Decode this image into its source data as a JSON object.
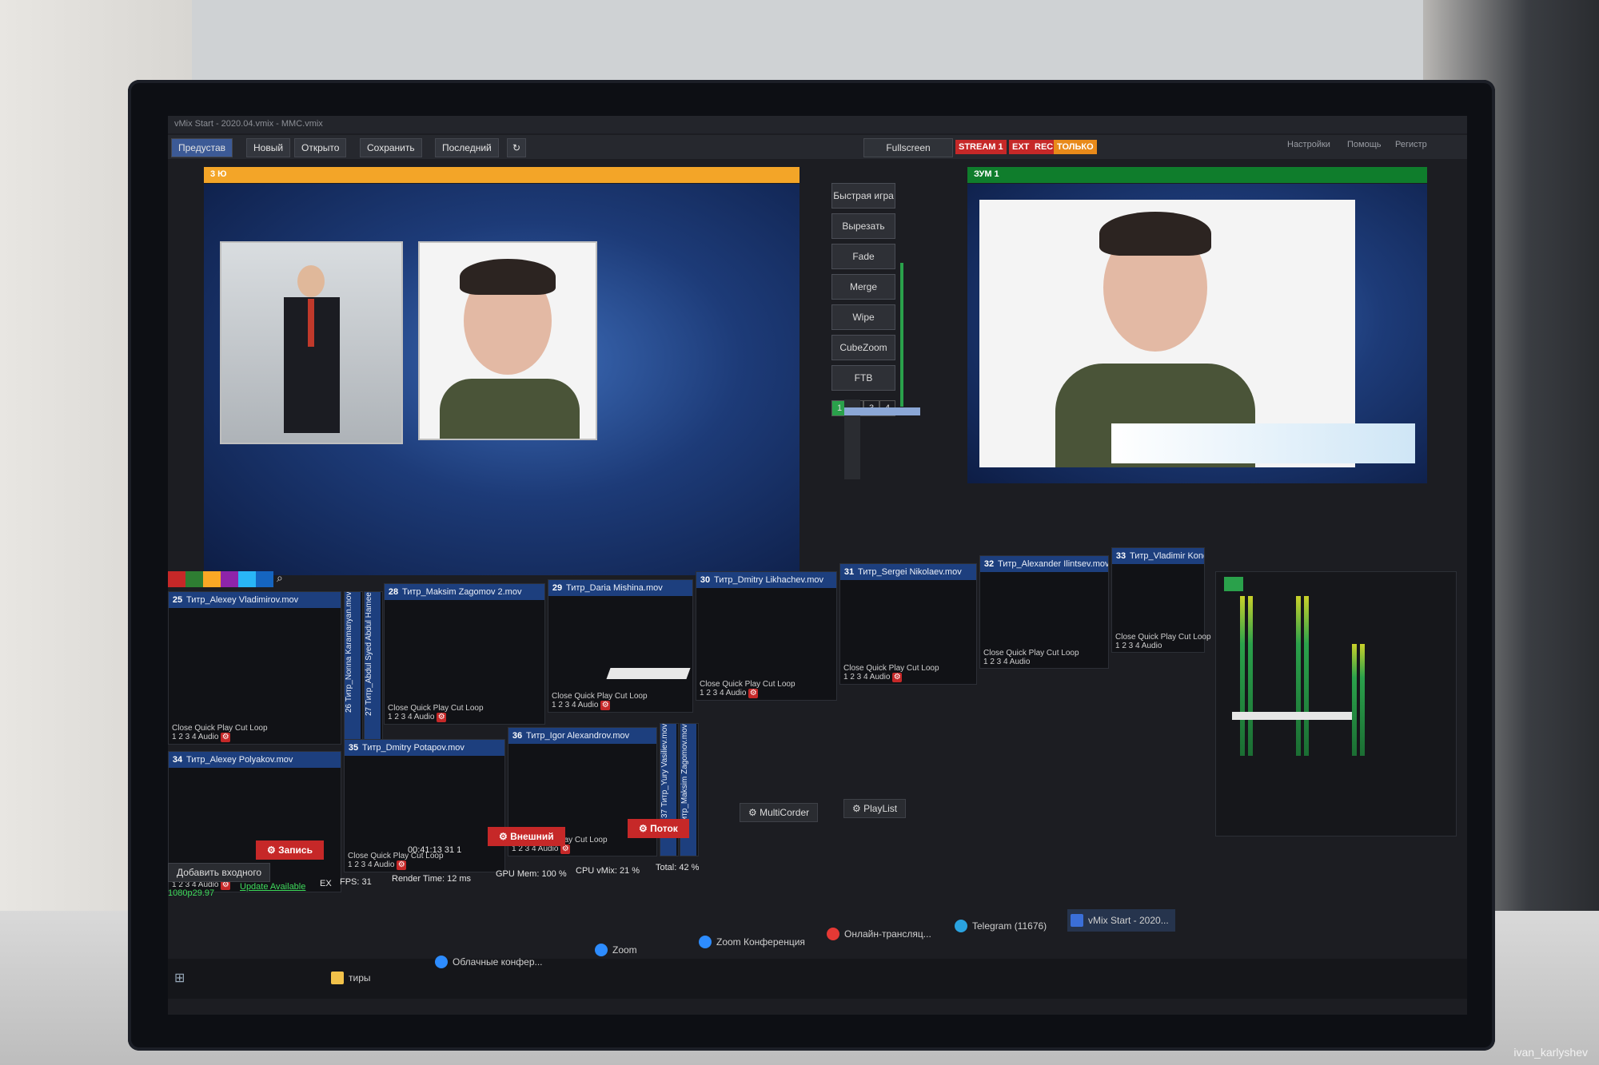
{
  "window": {
    "title": "vMix Start - 2020.04.vmix - MMC.vmix"
  },
  "menu": {
    "items": [
      "Предустав",
      "Новый",
      "Открыто",
      "Сохранить",
      "Последний"
    ],
    "fullscreen_label": "Fullscreen",
    "badges": [
      "STREAM 1",
      "EXT",
      "REC",
      "ТОЛЬКО"
    ],
    "right_items": [
      "Настройки",
      "Помощь",
      "Регистр"
    ]
  },
  "preview": {
    "label": "3 Ю"
  },
  "output": {
    "label": "ЗУМ 1"
  },
  "transitions": {
    "buttons": [
      "Быстрая игра",
      "Вырезать",
      "Fade",
      "Merge",
      "Wipe",
      "CubeZoom",
      "FTB"
    ],
    "numbers": [
      "1",
      "2",
      "3",
      "4"
    ]
  },
  "inputs": [
    {
      "num": "25",
      "title": "Титр_Alexey Vladimirov.mov"
    },
    {
      "num": "26",
      "title": "Титр_Nonna Karamanyan.mov"
    },
    {
      "num": "27",
      "title": "Титр_Abdul Syed Abdul Hamee"
    },
    {
      "num": "28",
      "title": "Титр_Maksim Zagomov 2.mov"
    },
    {
      "num": "29",
      "title": "Титр_Daria Mishina.mov"
    },
    {
      "num": "30",
      "title": "Титр_Dmitry Likhachev.mov"
    },
    {
      "num": "31",
      "title": "Титр_Sergei Nikolaev.mov"
    },
    {
      "num": "32",
      "title": "Титр_Alexander Ilintsev.mov"
    },
    {
      "num": "33",
      "title": "Титр_Vladimir Kondratenko"
    },
    {
      "num": "34",
      "title": "Титр_Alexey Polyakov.mov"
    },
    {
      "num": "35",
      "title": "Титр_Dmitry Potapov.mov"
    },
    {
      "num": "36",
      "title": "Титр_Igor Alexandrov.mov"
    },
    {
      "num": "37",
      "title": "Титр_Yury Vasiliev.mov"
    },
    {
      "num": "38",
      "title": "Титр_Maksim Zagomov.mov"
    }
  ],
  "input_controls": {
    "row1": "Close  Quick Play  Cut  Loop",
    "row2": "1  2  3  4  Audio"
  },
  "status": {
    "add_input": "Добавить входного",
    "record": "Запись",
    "timecode": "00:41:13 31 1",
    "external": "Внешний",
    "stream": "Поток",
    "multicorder": "MultiCorder",
    "playlist": "PlayList",
    "resolution": "1080p29.97",
    "update": "Update Available",
    "ex": "EX",
    "fps": "FPS: 31",
    "render": "Render Time: 12 ms",
    "gpu": "GPU Mem: 100 %",
    "cpu": "CPU vMix: 21 %",
    "total": "Total: 42 %"
  },
  "taskbar": [
    "тиры",
    "Облачные конфер...",
    "Zoom",
    "Zoom Конференция",
    "Онлайн-трансляц...",
    "Telegram (11676)",
    "vMix Start - 2020..."
  ],
  "colors": {
    "preview": "#f3a528",
    "output": "#0f7d2c",
    "input_header": "#1d3f7e",
    "record": "#c62828"
  },
  "photo_credit": "ivan_karlyshev"
}
